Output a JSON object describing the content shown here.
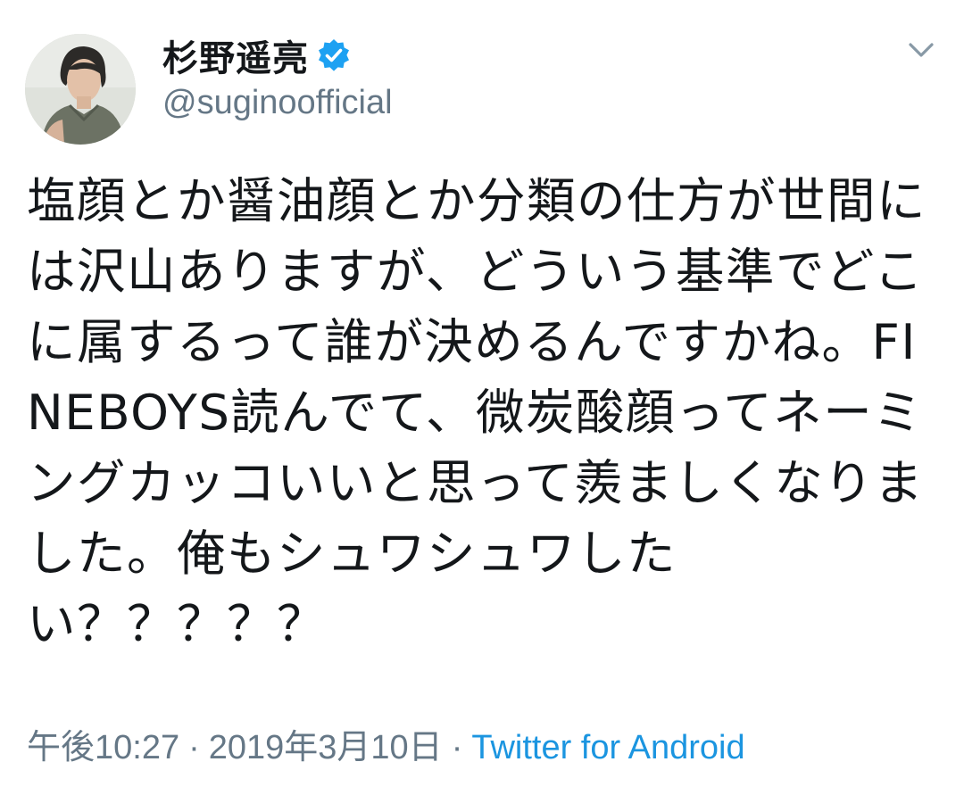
{
  "tweet": {
    "author": {
      "display_name": "杉野遥亮",
      "handle": "@suginoofficial",
      "verified": true
    },
    "text": "塩顔とか醤油顔とか分類の仕方が世間には沢山ありますが、どういう基準でどこに属するって誰が決めるんですかね。FINEBOYS読んでて、微炭酸顔ってネーミングカッコいいと思って羨ましくなりました。俺もシュワシュワしたい？？？？？",
    "time": "午後10:27",
    "date": "2019年3月10日",
    "separator": "·",
    "source": "Twitter for Android"
  },
  "icons": {
    "verified": "verified-badge-icon",
    "menu": "chevron-down-icon"
  },
  "colors": {
    "verified_blue": "#1da1f2",
    "link_blue": "#1b95e0",
    "secondary_text": "#657786",
    "primary_text": "#14171a"
  }
}
